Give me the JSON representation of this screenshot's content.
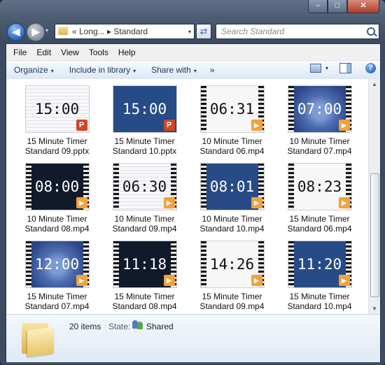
{
  "window": {
    "controls": {
      "minimize": "–",
      "maximize": "□",
      "close": "✕"
    }
  },
  "navigation": {
    "back_glyph": "◀",
    "forward_glyph": "▶",
    "history_caret": "▾",
    "address_text": "« Long... ▸ Standard",
    "address_caret": "▾",
    "refresh_glyph": "⇄",
    "search_placeholder": "Search Standard"
  },
  "menubar": {
    "items": [
      "File",
      "Edit",
      "View",
      "Tools",
      "Help"
    ]
  },
  "commandbar": {
    "organize": "Organize",
    "include_in_library": "Include in library",
    "share_with": "Share with",
    "more": "»",
    "caret": "▾",
    "help": "?"
  },
  "files": [
    {
      "thumb_text": "15:00",
      "line1": "15 Minute Timer",
      "line2": "Standard 09.pptx",
      "type": "pptx",
      "theme": "lined",
      "badge": "P"
    },
    {
      "thumb_text": "15:00",
      "line1": "15 Minute Timer",
      "line2": "Standard 10.pptx",
      "type": "pptx",
      "theme": "blue",
      "badge": "P"
    },
    {
      "thumb_text": "06:31",
      "line1": "10 Minute Timer",
      "line2": "Standard 06.mp4",
      "type": "mp4",
      "theme": "white",
      "badge": "▶"
    },
    {
      "thumb_text": "07:00",
      "line1": "10 Minute Timer",
      "line2": "Standard 07.mp4",
      "type": "mp4",
      "theme": "clock",
      "badge": "▶"
    },
    {
      "thumb_text": "08:00",
      "line1": "10 Minute Timer",
      "line2": "Standard 08.mp4",
      "type": "mp4",
      "theme": "dark",
      "badge": "▶"
    },
    {
      "thumb_text": "06:30",
      "line1": "10 Minute Timer",
      "line2": "Standard 09.mp4",
      "type": "mp4",
      "theme": "lined",
      "badge": "▶"
    },
    {
      "thumb_text": "08:01",
      "line1": "10 Minute Timer",
      "line2": "Standard 10.mp4",
      "type": "mp4",
      "theme": "blue",
      "badge": "▶"
    },
    {
      "thumb_text": "08:23",
      "line1": "15 Minute Timer",
      "line2": "Standard 06.mp4",
      "type": "mp4",
      "theme": "white",
      "badge": "▶"
    },
    {
      "thumb_text": "12:00",
      "line1": "15 Minute Timer",
      "line2": "Standard 07.mp4",
      "type": "mp4",
      "theme": "clock",
      "badge": "▶"
    },
    {
      "thumb_text": "11:18",
      "line1": "15 Minute Timer",
      "line2": "Standard 08.mp4",
      "type": "mp4",
      "theme": "dark",
      "badge": "▶"
    },
    {
      "thumb_text": "14:26",
      "line1": "15 Minute Timer",
      "line2": "Standard 09.mp4",
      "type": "mp4",
      "theme": "white",
      "badge": "▶"
    },
    {
      "thumb_text": "11:20",
      "line1": "15 Minute Timer",
      "line2": "Standard 10.mp4",
      "type": "mp4",
      "theme": "blue",
      "badge": "▶"
    }
  ],
  "scrollbar": {
    "up": "▲",
    "down": "▼"
  },
  "details": {
    "item_count": "20 items",
    "state_label": "State:",
    "state_value": "Shared"
  },
  "colors": {
    "accent": "#274b86",
    "command_bar": "#dbe7f4",
    "pptx_badge": "#d24726",
    "mp4_badge": "#f2a238"
  }
}
